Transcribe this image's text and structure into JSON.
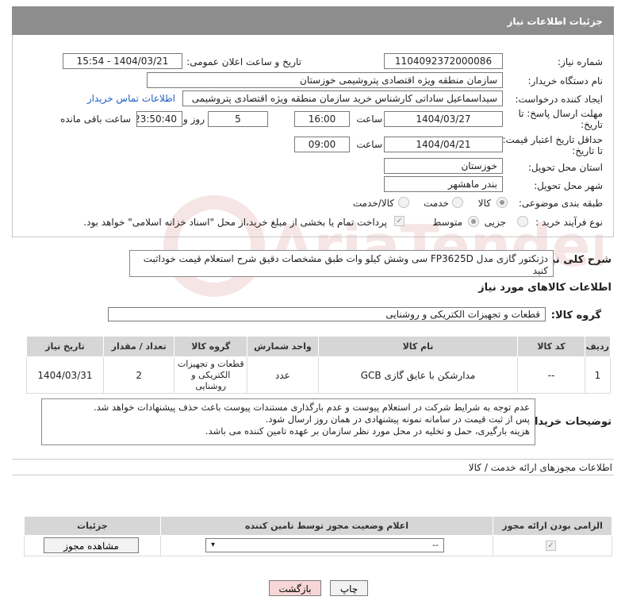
{
  "header": {
    "title": "جزئیات اطلاعات نیاز"
  },
  "fields": {
    "need_number_label": "شماره نیاز:",
    "need_number": "1104092372000086",
    "announce_label": "تاریخ و ساعت اعلان عمومی:",
    "announce_value": "1404/03/21 - 15:54",
    "buyer_org_label": "نام دستگاه خریدار:",
    "buyer_org": "سازمان منطقه ویژه اقتصادی پتروشیمی خوزستان",
    "creator_label": "ایجاد کننده درخواست:",
    "creator": "سیداسماعیل ساداتی کارشناس خرید سازمان منطقه ویژه اقتصادی پتروشیمی",
    "buyer_contact_link": "اطلاعات تماس خریدار",
    "deadline_label_1": "مهلت ارسال پاسخ: تا",
    "deadline_label_2": "تاریخ:",
    "deadline_date": "1404/03/27",
    "time_label": "ساعت",
    "deadline_time": "16:00",
    "days_value": "5",
    "days_label": "روز و",
    "remaining_time": "23:50:40",
    "remaining_label": "ساعت باقی مانده",
    "validity_label_1": "حداقل تاریخ اعتبار قیمت:",
    "validity_label_2": "تا تاریخ:",
    "validity_date": "1404/04/21",
    "validity_time": "09:00",
    "province_label": "استان محل تحویل:",
    "province": "خوزستان",
    "city_label": "شهر محل تحویل:",
    "city": "بندر ماهشهر",
    "category_label": "طبقه بندی موضوعی:",
    "category_options": [
      "کالا",
      "خدمت",
      "کالا/خدمت"
    ],
    "process_label": "نوع فرآیند خرید :",
    "process_options": [
      "جزیی",
      "متوسط"
    ],
    "payment_note": "پرداخت تمام یا بخشی از مبلغ خرید،از محل \"اسناد خزانه اسلامی\" خواهد بود."
  },
  "description": {
    "label": "شرح کلی نیاز:",
    "text": "دژنکتور گازی مدل FP3625D سی وشش کیلو وات طبق مشخصات دقیق شرح استعلام قیمت خوداثبت کنید\nلطفا فقط بند خواسته شده"
  },
  "goods": {
    "section_title": "اطلاعات کالاهای مورد نیاز",
    "group_label": "گروه کالا:",
    "group_value": "قطعات و تجهیزات الکتریکی و روشنایی",
    "columns": [
      "ردیف",
      "کد کالا",
      "نام کالا",
      "واحد شمارش",
      "گروه کالا",
      "تعداد / مقدار",
      "تاریخ نیاز"
    ],
    "rows": [
      {
        "row": "1",
        "code": "--",
        "name": "مدارشکن با عایق گازی GCB",
        "unit": "عدد",
        "group": "قطعات و تجهیزات الکتریکی و روشنایی",
        "qty": "2",
        "date": "1404/03/31"
      }
    ]
  },
  "buyer_notes": {
    "label": "توضیحات خریدار:",
    "text": "عدم توجه به شرایط شرکت در استعلام پیوست و عدم بارگذاری مستندات پیوست باعث حذف پیشنهادات خواهد شد.\nپس از ثبت قیمت در سامانه نمونه پیشنهادی در همان روز ارسال شود.\nهزینه بارگیری، حمل و تخلیه در محل مورد نظر سازمان بر عهده تامین کننده می باشد."
  },
  "permits": {
    "section_title": "اطلاعات مجوزهای ارائه خدمت / کالا",
    "columns": [
      "الزامی بودن ارائه مجوز",
      "اعلام وضعیت مجوز توسط تامین کننده",
      "جزئیات"
    ],
    "select_value": "--",
    "view_button": "مشاهده مجوز"
  },
  "actions": {
    "print": "چاپ",
    "back": "بازگشت"
  },
  "watermark": {
    "text": "AriaTender.net"
  },
  "colors": {
    "header_bg": "#8d8d8d",
    "link": "#1f5fc3",
    "back_btn_bg": "#f7d6d6"
  }
}
